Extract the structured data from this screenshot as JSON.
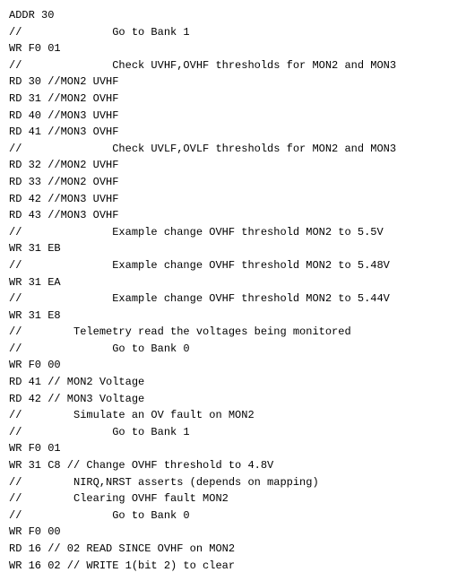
{
  "code": {
    "lines": [
      "ADDR 30",
      "//              Go to Bank 1",
      "WR F0 01",
      "//              Check UVHF,OVHF thresholds for MON2 and MON3",
      "RD 30 //MON2 UVHF",
      "RD 31 //MON2 OVHF",
      "RD 40 //MON3 UVHF",
      "RD 41 //MON3 OVHF",
      "//              Check UVLF,OVLF thresholds for MON2 and MON3",
      "RD 32 //MON2 UVHF",
      "RD 33 //MON2 OVHF",
      "RD 42 //MON3 UVHF",
      "RD 43 //MON3 OVHF",
      "//              Example change OVHF threshold MON2 to 5.5V",
      "WR 31 EB",
      "//              Example change OVHF threshold MON2 to 5.48V",
      "WR 31 EA",
      "//              Example change OVHF threshold MON2 to 5.44V",
      "WR 31 E8",
      "//        Telemetry read the voltages being monitored",
      "//              Go to Bank 0",
      "WR F0 00",
      "RD 41 // MON2 Voltage",
      "RD 42 // MON3 Voltage",
      "//        Simulate an OV fault on MON2",
      "//              Go to Bank 1",
      "WR F0 01",
      "WR 31 C8 // Change OVHF threshold to 4.8V",
      "//        NIRQ,NRST asserts (depends on mapping)",
      "//        Clearing OVHF fault MON2",
      "//              Go to Bank 0",
      "WR F0 00",
      "RD 16 // 02 READ SINCE OVHF on MON2",
      "WR 16 02 // WRITE 1(bit 2) to clear"
    ]
  }
}
